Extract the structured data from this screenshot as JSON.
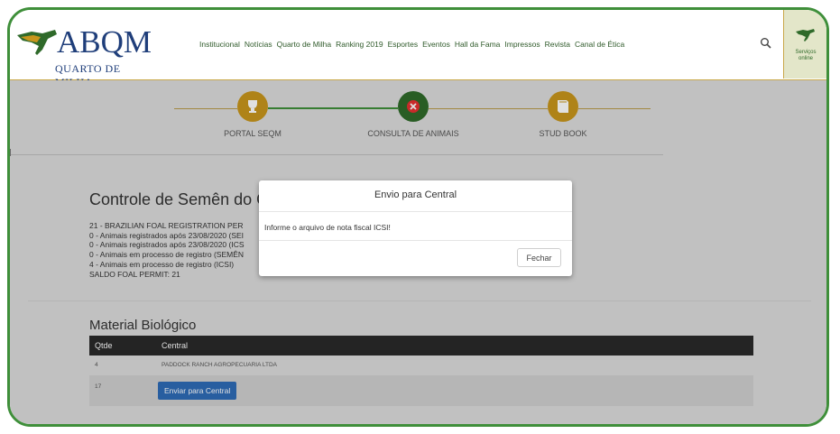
{
  "brand": {
    "name": "ABQM",
    "subtitle": "QUARTO DE MILHA"
  },
  "nav": {
    "items": [
      "Institucional",
      "Notícias",
      "Quarto de Milha",
      "Ranking 2019",
      "Esportes",
      "Eventos",
      "Hall da Fama",
      "Impressos",
      "Revista",
      "Canal de Ética"
    ]
  },
  "servicos": {
    "label_line1": "Serviços",
    "label_line2": "online"
  },
  "steps": [
    {
      "label": "PORTAL SEQM",
      "color": "#c8961c"
    },
    {
      "label": "CONSULTA DE ANIMAIS",
      "color": "#2f6a2a"
    },
    {
      "label": "STUD BOOK",
      "color": "#c8961c"
    }
  ],
  "section": {
    "title": "Controle de Semên do Ga",
    "lines": [
      "21 - BRAZILIAN FOAL REGISTRATION PER",
      "0 - Animais registrados após 23/08/2020 (SEI",
      "0 - Animais registrados após 23/08/2020 (ICS",
      "0 - Animais em processo de registro (SEMÊN",
      "4 - Animais em processo de registro (ICSI)",
      "SALDO FOAL PERMIT: 21"
    ]
  },
  "material": {
    "title": "Material Biológico",
    "headers": {
      "qtde": "Qtde",
      "central": "Central"
    },
    "rows": [
      {
        "qtde": "4",
        "central": "PADDOCK RANCH AGROPECUARIA LTDA"
      },
      {
        "qtde": "17",
        "button": "Enviar para Central"
      }
    ]
  },
  "modal": {
    "title": "Envio para Central",
    "message": "Informe o arquivo de nota fiscal ICSI!",
    "close_label": "Fechar"
  },
  "colors": {
    "frame": "#3f8f3a",
    "accent_gold": "#c8961c",
    "accent_green": "#2f6a2a",
    "button_blue": "#2e6bb7"
  }
}
